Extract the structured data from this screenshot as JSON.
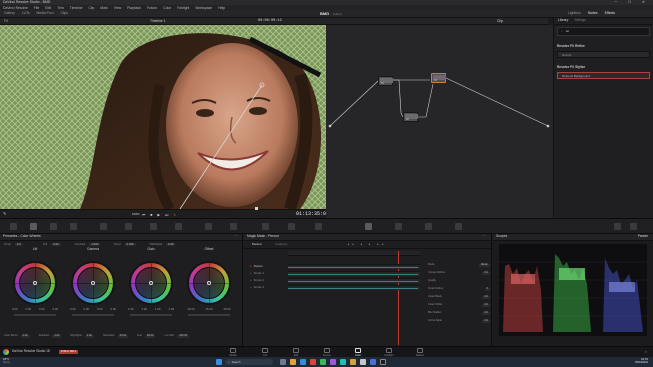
{
  "window": {
    "title": "DaVinci Resolve Studio - BMD"
  },
  "menu": [
    "DaVinci Resolve",
    "File",
    "Edit",
    "Trim",
    "Timeline",
    "Clip",
    "Mark",
    "View",
    "Playback",
    "Fusion",
    "Color",
    "Fairlight",
    "Workspace",
    "Help"
  ],
  "toolbar": {
    "left": [
      "Gallery",
      "LUTs",
      "Media Pool",
      "Clips"
    ],
    "project": "BMD",
    "project_status": "Edited",
    "right": [
      "Lightbox",
      "Nodes",
      "Effects"
    ]
  },
  "viewer_bar": {
    "zoom": "Fit",
    "timeline": "Timeline 1",
    "timecode": "00:00:00:12",
    "clip": "Clip"
  },
  "viewer": {
    "frame_label": "100%",
    "timecode": "01:13:35:07"
  },
  "library": {
    "tabs": [
      "Library",
      "Settings"
    ],
    "search": "rel",
    "sections": [
      {
        "title": "Resolve FX Refine",
        "items": [
          "Relight"
        ]
      },
      {
        "title": "Resolve FX Stylize",
        "items": [
          "Defocus Background"
        ]
      }
    ]
  },
  "nodes": [
    {
      "label": "01"
    },
    {
      "label": "02"
    },
    {
      "label": "03"
    },
    {
      "label": "04"
    }
  ],
  "color_wheels": {
    "title": "Primaries - Color Wheels",
    "params": [
      {
        "label": "Temp",
        "value": "0.0"
      },
      {
        "label": "Tint",
        "value": "0.00"
      },
      {
        "label": "Contrast",
        "value": "1.000"
      },
      {
        "label": "Pivot",
        "value": "0.435"
      },
      {
        "label": "Mid/Detail",
        "value": "0.00"
      }
    ],
    "wheels": [
      {
        "name": "Lift",
        "values": [
          "0.00",
          "0.00",
          "0.00",
          "0.00"
        ]
      },
      {
        "name": "Gamma",
        "values": [
          "0.00",
          "0.00",
          "0.00",
          "0.00"
        ]
      },
      {
        "name": "Gain",
        "values": [
          "1.00",
          "1.00",
          "1.00",
          "1.00"
        ]
      },
      {
        "name": "Offset",
        "values": [
          "25.00",
          "25.00",
          "25.00"
        ]
      }
    ],
    "footer": [
      {
        "label": "Color Boost",
        "value": "0.00"
      },
      {
        "label": "Shadows",
        "value": "0.00"
      },
      {
        "label": "Highlights",
        "value": "0.00"
      },
      {
        "label": "Saturation",
        "value": "50.00"
      },
      {
        "label": "Hue",
        "value": "50.00"
      },
      {
        "label": "Lum Mix",
        "value": "100.00"
      }
    ]
  },
  "magic_mask": {
    "title": "Magic Mask - Person",
    "tabs": [
      "Person",
      "Features"
    ],
    "tracks": [
      {
        "name": "Person"
      },
      {
        "name": "Stroke 1"
      },
      {
        "name": "Stroke 2"
      },
      {
        "name": "Stroke 3"
      }
    ],
    "props": [
      {
        "label": "Mode",
        "value": "Better"
      },
      {
        "label": "Consec Refine",
        "value": "0.0"
      },
      {
        "label": "Quality",
        "value": ""
      },
      {
        "label": "Smart Refine",
        "value": "0"
      },
      {
        "label": "Clean Black",
        "value": "0.0"
      },
      {
        "label": "Clean White",
        "value": "0.0"
      },
      {
        "label": "Blur Radius",
        "value": "0.0"
      },
      {
        "label": "In/Out Ratio",
        "value": "0.0"
      }
    ]
  },
  "scopes": {
    "title": "Scopes",
    "mode": "Parade"
  },
  "pages": [
    {
      "name": "Media"
    },
    {
      "name": "Cut"
    },
    {
      "name": "Edit"
    },
    {
      "name": "Fusion"
    },
    {
      "name": "Color",
      "active": true
    },
    {
      "name": "Fairlight"
    },
    {
      "name": "Deliver"
    }
  ],
  "footer_brand": "DaVinci Resolve Studio 18",
  "footer_badge": "PUBLIC BETA",
  "taskbar": {
    "weather_temp": "18°C",
    "weather_text": "Sunny",
    "search": "Search",
    "time": "22:54",
    "date": "05/04/2024"
  },
  "colors": {
    "accent": "#c28a1d",
    "selected_node": "#c28a1d",
    "track_line": "#3e7f84"
  }
}
